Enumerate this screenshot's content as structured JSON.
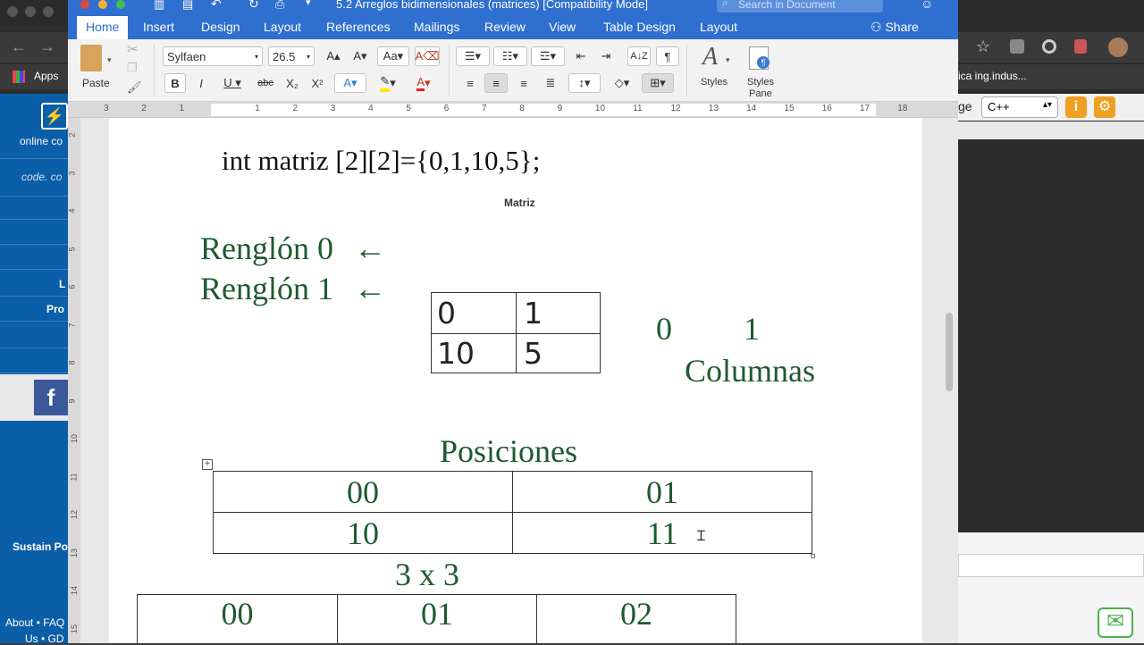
{
  "window": {
    "title": "5.2 Arreglos bidimensionales (matrices) [Compatibility Mode]",
    "search_placeholder": "Search in Document"
  },
  "ribbon": {
    "tabs": [
      "Home",
      "Insert",
      "Design",
      "Layout",
      "References",
      "Mailings",
      "Review",
      "View",
      "Table Design",
      "Layout"
    ],
    "share": "Share"
  },
  "toolbar": {
    "paste": "Paste",
    "font": "Sylfaen",
    "size": "26.5",
    "styles": "Styles",
    "styles_pane_1": "Styles",
    "styles_pane_2": "Pane"
  },
  "ruler": {
    "marks": [
      "3",
      "2",
      "1",
      "",
      "1",
      "2",
      "3",
      "4",
      "5",
      "6",
      "7",
      "8",
      "9",
      "10",
      "11",
      "12",
      "13",
      "14",
      "15",
      "16",
      "17",
      "18"
    ]
  },
  "vruler": {
    "marks": [
      "2",
      "3",
      "4",
      "5",
      "6",
      "7",
      "8",
      "9",
      "10",
      "11",
      "12",
      "13",
      "14",
      "15"
    ]
  },
  "browser": {
    "apps": "Apps",
    "left_labels": [
      "online co",
      "code. co",
      "L",
      "Pro",
      "Sustain Po",
      "About • FAQ",
      "Us • GD"
    ],
    "bookmark": "ica ing.indus...",
    "lang_label": "ge",
    "language": "C++"
  },
  "document": {
    "code_line": "int matriz [2][2]={0,1,10,5};",
    "caption": "Matriz",
    "row0": "Renglón  0",
    "row1": "Renglón  1",
    "arrow": "←",
    "matrix": [
      [
        "0",
        "1"
      ],
      [
        "10",
        "5"
      ]
    ],
    "col_nums": [
      "0",
      "1"
    ],
    "columns": "Columnas",
    "positions_title": "Posiciones",
    "positions": [
      [
        "00",
        "01"
      ],
      [
        "10",
        "11"
      ]
    ],
    "size3": "3 x 3",
    "pos3": [
      "00",
      "01",
      "02"
    ]
  },
  "colors": {
    "ribbon": "#2e6fcf",
    "green_text": "#1e5a2e",
    "fb": "#3b5998"
  }
}
